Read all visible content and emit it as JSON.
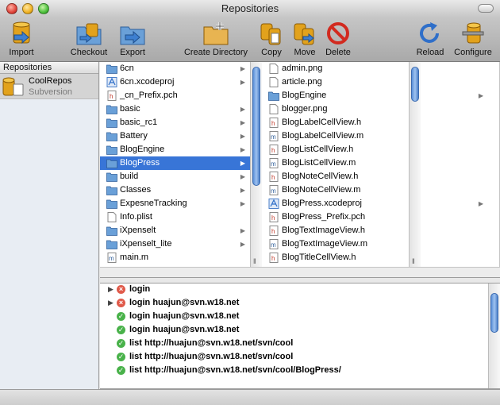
{
  "window": {
    "title": "Repositories"
  },
  "toolbar": {
    "import": "Import",
    "checkout": "Checkout",
    "export": "Export",
    "create_directory": "Create Directory",
    "copy": "Copy",
    "move": "Move",
    "delete": "Delete",
    "reload": "Reload",
    "configure": "Configure"
  },
  "sidebar": {
    "header": "Repositories",
    "repos": [
      {
        "name": "CoolRepos",
        "type": "Subversion"
      }
    ]
  },
  "column1": [
    {
      "name": "6cn",
      "icon": "folder-icon",
      "has_children": true
    },
    {
      "name": "6cn.xcodeproj",
      "icon": "xcodeproj-icon",
      "has_children": true
    },
    {
      "name": "_cn_Prefix.pch",
      "icon": "header-file-icon",
      "has_children": false
    },
    {
      "name": "basic",
      "icon": "folder-icon",
      "has_children": true
    },
    {
      "name": "basic_rc1",
      "icon": "folder-icon",
      "has_children": true
    },
    {
      "name": "Battery",
      "icon": "folder-icon",
      "has_children": true
    },
    {
      "name": "BlogEngine",
      "icon": "folder-icon",
      "has_children": true
    },
    {
      "name": "BlogPress",
      "icon": "folder-icon",
      "has_children": true,
      "selected": true
    },
    {
      "name": "build",
      "icon": "folder-icon",
      "has_children": true
    },
    {
      "name": "Classes",
      "icon": "folder-icon",
      "has_children": true
    },
    {
      "name": "ExpesneTracking",
      "icon": "folder-icon",
      "has_children": true
    },
    {
      "name": "Info.plist",
      "icon": "file-icon",
      "has_children": false
    },
    {
      "name": "iXpenselt",
      "icon": "folder-icon",
      "has_children": true
    },
    {
      "name": "iXpenselt_lite",
      "icon": "folder-icon",
      "has_children": true
    },
    {
      "name": "main.m",
      "icon": "m-file-icon",
      "has_children": false
    }
  ],
  "column2": [
    {
      "name": "admin.png",
      "icon": "file-icon",
      "has_children": false
    },
    {
      "name": "article.png",
      "icon": "file-icon",
      "has_children": false
    },
    {
      "name": "BlogEngine",
      "icon": "folder-icon",
      "has_children": true
    },
    {
      "name": "blogger.png",
      "icon": "file-icon",
      "has_children": false
    },
    {
      "name": "BlogLabelCellView.h",
      "icon": "header-file-icon",
      "has_children": false
    },
    {
      "name": "BlogLabelCellView.m",
      "icon": "m-file-icon",
      "has_children": false
    },
    {
      "name": "BlogListCellView.h",
      "icon": "header-file-icon",
      "has_children": false
    },
    {
      "name": "BlogListCellView.m",
      "icon": "m-file-icon",
      "has_children": false
    },
    {
      "name": "BlogNoteCellView.h",
      "icon": "header-file-icon",
      "has_children": false
    },
    {
      "name": "BlogNoteCellView.m",
      "icon": "m-file-icon",
      "has_children": false
    },
    {
      "name": "BlogPress.xcodeproj",
      "icon": "xcodeproj-icon",
      "has_children": true
    },
    {
      "name": "BlogPress_Prefix.pch",
      "icon": "header-file-icon",
      "has_children": false
    },
    {
      "name": "BlogTextImageView.h",
      "icon": "header-file-icon",
      "has_children": false
    },
    {
      "name": "BlogTextImageView.m",
      "icon": "m-file-icon",
      "has_children": false
    },
    {
      "name": "BlogTitleCellView.h",
      "icon": "header-file-icon",
      "has_children": false
    }
  ],
  "log": [
    {
      "status": "error",
      "expandable": true,
      "text": "login"
    },
    {
      "status": "error",
      "expandable": true,
      "text": "login huajun@svn.w18.net"
    },
    {
      "status": "ok",
      "expandable": false,
      "text": "login huajun@svn.w18.net"
    },
    {
      "status": "ok",
      "expandable": false,
      "text": "login huajun@svn.w18.net"
    },
    {
      "status": "ok",
      "expandable": false,
      "text": "list http://huajun@svn.w18.net/svn/cool"
    },
    {
      "status": "ok",
      "expandable": false,
      "text": "list http://huajun@svn.w18.net/svn/cool"
    },
    {
      "status": "ok",
      "expandable": false,
      "text": "list http://huajun@svn.w18.net/svn/cool/BlogPress/"
    }
  ],
  "colors": {
    "selection": "#3875d7",
    "ok": "#49b24a",
    "error": "#e05a4a",
    "folder": "#6aa0d8"
  }
}
